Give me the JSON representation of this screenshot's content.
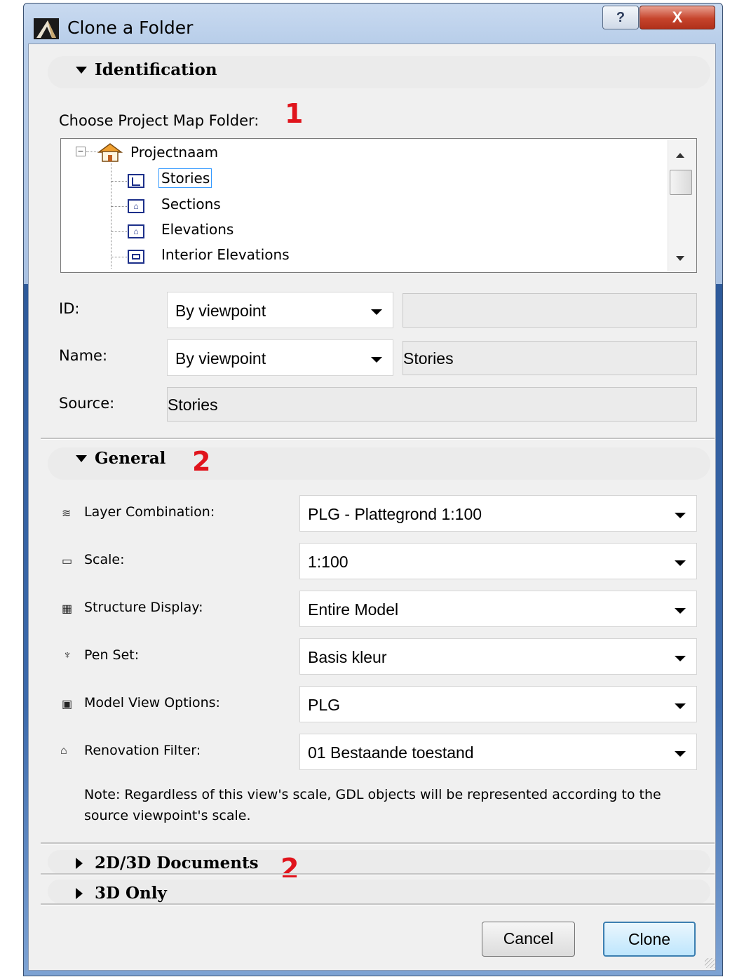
{
  "window": {
    "title": "Clone a Folder",
    "help_label": "?",
    "close_label": "X"
  },
  "identification": {
    "title": "Identification",
    "choose_label": "Choose Project Map Folder:",
    "marker": "1",
    "tree": {
      "root": "Projectnaam",
      "items": [
        {
          "label": "Stories",
          "selected": true,
          "icon": "story-icon"
        },
        {
          "label": "Sections",
          "selected": false,
          "icon": "section-icon"
        },
        {
          "label": "Elevations",
          "selected": false,
          "icon": "elevation-icon"
        },
        {
          "label": "Interior Elevations",
          "selected": false,
          "icon": "interior-elevation-icon"
        }
      ]
    },
    "id": {
      "label": "ID:",
      "mode": "By viewpoint",
      "value": ""
    },
    "name": {
      "label": "Name:",
      "mode": "By viewpoint",
      "value": "Stories"
    },
    "source": {
      "label": "Source:",
      "value": "Stories"
    }
  },
  "general": {
    "title": "General",
    "marker": "2",
    "rows": [
      {
        "label": "Layer Combination:",
        "value": "PLG - Plattegrond 1:100",
        "icon": "layers-icon"
      },
      {
        "label": "Scale:",
        "value": "1:100",
        "icon": "ruler-icon"
      },
      {
        "label": "Structure Display:",
        "value": "Entire Model",
        "icon": "structure-icon"
      },
      {
        "label": "Pen Set:",
        "value": "Basis kleur",
        "icon": "pen-icon"
      },
      {
        "label": "Model View Options:",
        "value": "PLG",
        "icon": "model-view-icon"
      },
      {
        "label": "Renovation Filter:",
        "value": "01 Bestaande toestand",
        "icon": "renovation-icon"
      }
    ],
    "note": "Note: Regardless of this view's scale, GDL objects will be represented according to the source viewpoint's scale."
  },
  "collapsed_sections": [
    {
      "title": "2D/3D Documents"
    },
    {
      "title": "3D Only"
    }
  ],
  "collapsed_marker": "2",
  "buttons": {
    "cancel": "Cancel",
    "clone": "Clone"
  },
  "colors": {
    "accent": "#e0141c",
    "selection": "#3399ff",
    "close": "#c6442c"
  }
}
